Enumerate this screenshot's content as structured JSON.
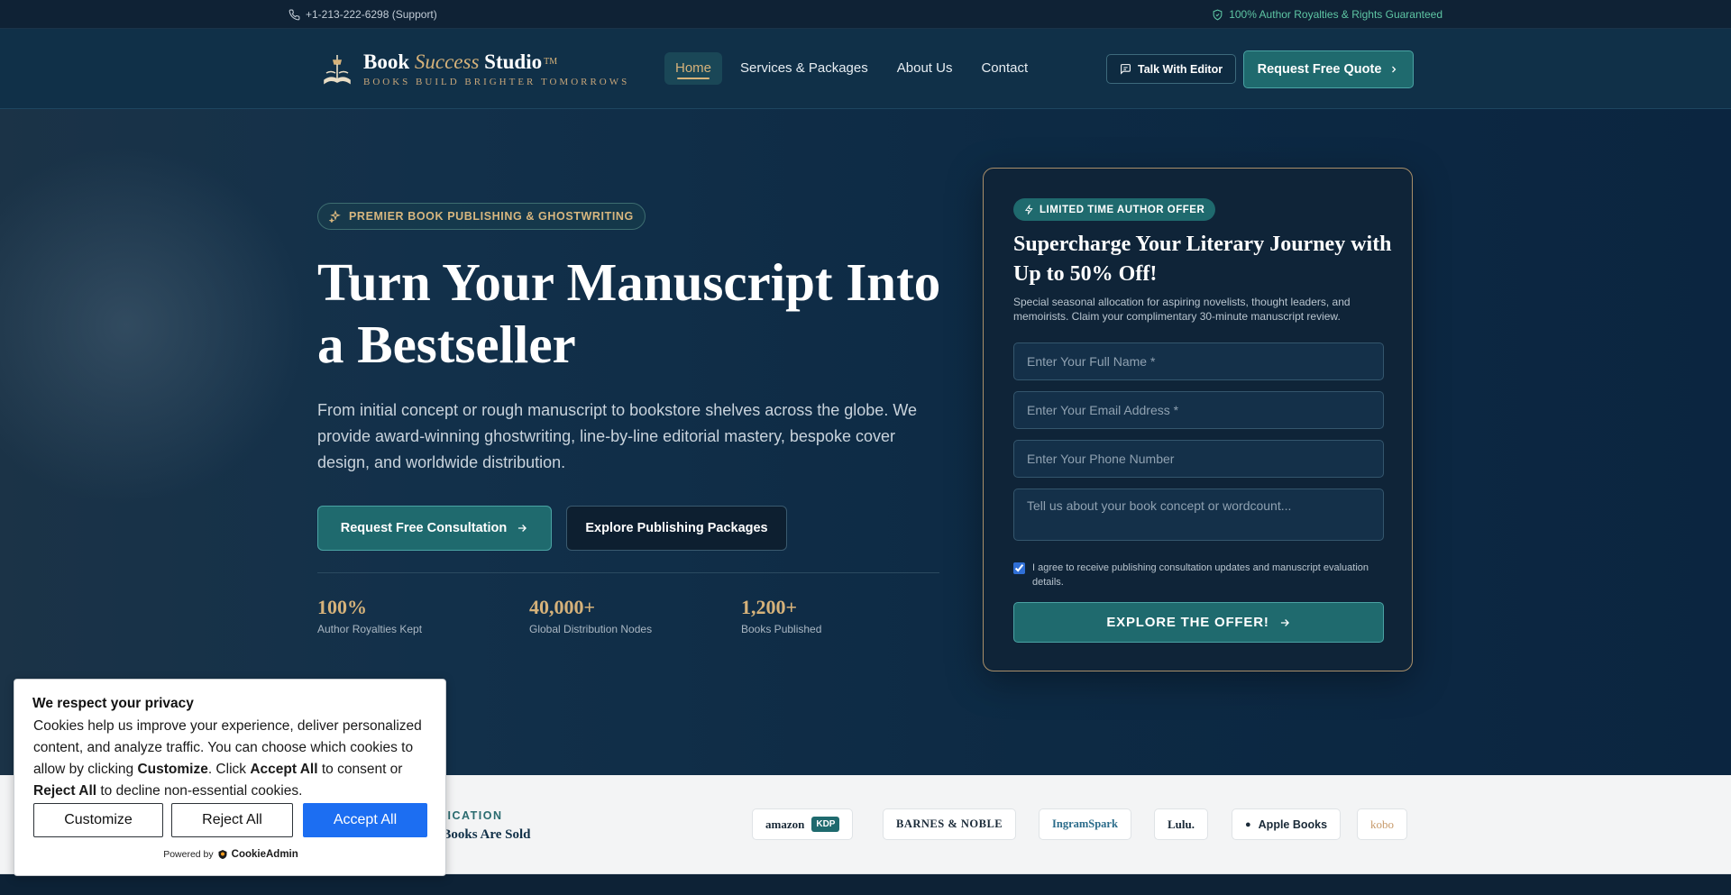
{
  "topbar": {
    "phone": "+1-213-222-6298 (Support)",
    "guarantee": "100% Author Royalties & Rights Guaranteed"
  },
  "brand": {
    "word1": "Book",
    "word2": "Success",
    "word3": "Studio",
    "tm": "TM",
    "tagline": "BOOKS BUILD BRIGHTER TOMORROWS"
  },
  "nav": {
    "items": [
      "Home",
      "Services & Packages",
      "About Us",
      "Contact"
    ],
    "active": "Home"
  },
  "header_actions": {
    "editor_label": "Talk With Editor",
    "quote_label": "Request Free Quote"
  },
  "hero": {
    "badge": "PREMIER BOOK PUBLISHING & GHOSTWRITING",
    "title": "Turn Your Manuscript Into a Bestseller",
    "subtitle": "From initial concept or rough manuscript to bookstore shelves across the globe. We provide award-winning ghostwriting, line-by-line editorial mastery, bespoke cover design, and worldwide distribution.",
    "primary_cta": "Request Free Consultation",
    "secondary_cta": "Explore Publishing Packages",
    "stats": [
      {
        "value": "100%",
        "label": "Author Royalties Kept"
      },
      {
        "value": "40,000+",
        "label": "Global Distribution Nodes"
      },
      {
        "value": "1,200+",
        "label": "Books Published"
      }
    ]
  },
  "offer": {
    "badge": "LIMITED TIME AUTHOR OFFER",
    "title": "Supercharge Your Literary Journey with Up to 50% Off!",
    "description": "Special seasonal allocation for aspiring novelists, thought leaders, and memoirists. Claim your complimentary 30-minute manuscript review.",
    "name_placeholder": "Enter Your Full Name *",
    "email_placeholder": "Enter Your Email Address *",
    "phone_placeholder": "Enter Your Phone Number",
    "message_placeholder": "Tell us about your book concept or wordcount...",
    "consent_text": "I agree to receive publishing consultation updates and manuscript evaluation details.",
    "consent_checked": true,
    "submit_label": "EXPLORE THE OFFER!"
  },
  "syndication": {
    "kicker": "DICATION",
    "heading": "e Books Are Sold",
    "retailers": [
      "amazon",
      "KDP",
      "BARNES & NOBLE",
      "IngramSpark",
      "Lulu.",
      "Apple Books",
      "kobo"
    ]
  },
  "cookie": {
    "title": "We respect your privacy",
    "text_1": "Cookies help us improve your experience, deliver personalized content, and analyze traffic. You can choose which cookies to allow by clicking ",
    "bold_customize": "Customize",
    "text_2": ". Click ",
    "bold_accept": "Accept All",
    "text_3": " to consent or ",
    "bold_reject": "Reject All",
    "text_4": " to decline non-essential cookies.",
    "customize_label": "Customize",
    "reject_label": "Reject All",
    "accept_label": "Accept All",
    "powered_by": "Powered by",
    "provider": "CookieAdmin"
  },
  "colors": {
    "navy": "#0d2236",
    "teal": "#1f6a6e",
    "gold": "#d6b27a",
    "green_text": "#5ec6a4",
    "cookie_accept": "#1c6ef2"
  }
}
